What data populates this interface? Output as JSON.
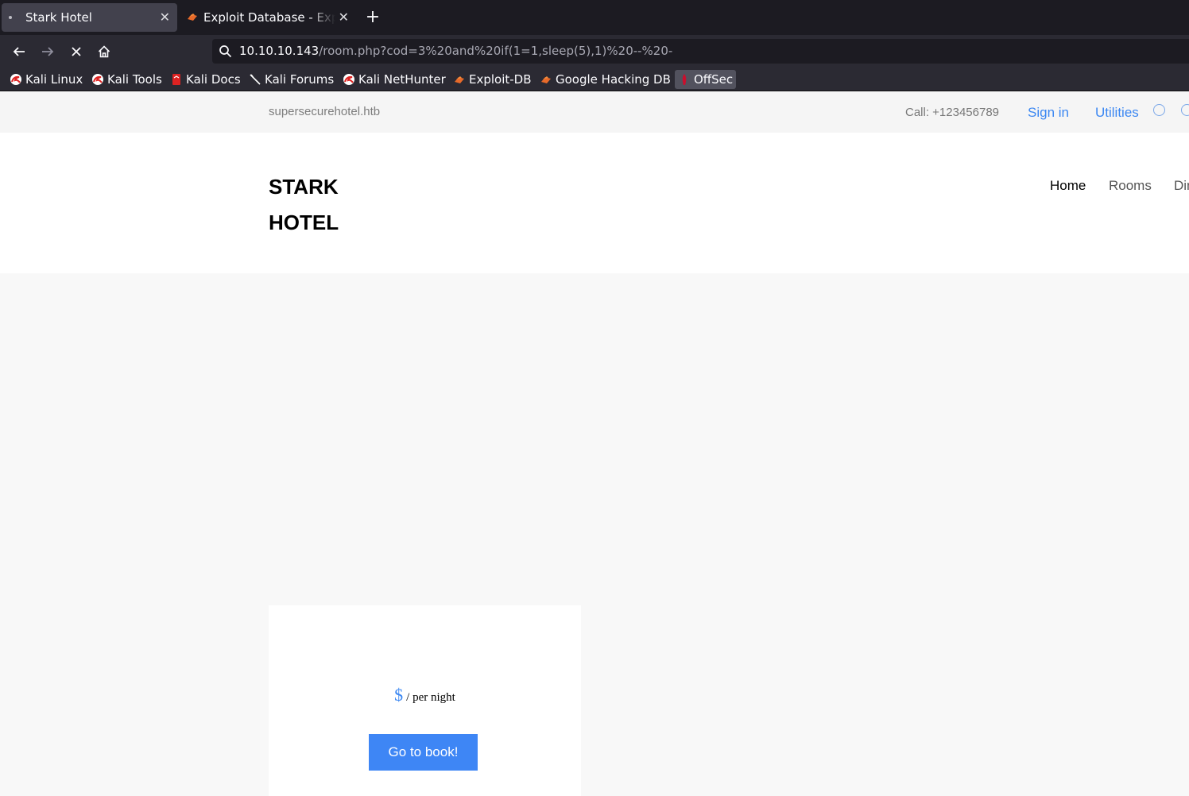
{
  "browser": {
    "tabs": [
      {
        "title": "Stark Hotel",
        "active": true
      },
      {
        "title": "Exploit Database - Exploit",
        "active": false
      }
    ],
    "url": {
      "host": "10.10.10.143",
      "path": "/room.php?cod=3%20and%20if(1=1,sleep(5),1)%20--%20-"
    },
    "bookmarks": [
      {
        "label": "Kali Linux",
        "icon": "kali-icon"
      },
      {
        "label": "Kali Tools",
        "icon": "kali-icon"
      },
      {
        "label": "Kali Docs",
        "icon": "kali-docs-icon"
      },
      {
        "label": "Kali Forums",
        "icon": "kali-forums-icon"
      },
      {
        "label": "Kali NetHunter",
        "icon": "kali-icon"
      },
      {
        "label": "Exploit-DB",
        "icon": "exploit-db-icon"
      },
      {
        "label": "Google Hacking DB",
        "icon": "exploit-db-icon"
      },
      {
        "label": "OffSec",
        "icon": "offsec-icon"
      }
    ]
  },
  "page": {
    "topbar": {
      "domain": "supersecurehotel.htb",
      "call": "Call: +123456789",
      "sign_in": "Sign in",
      "utilities": "Utilities"
    },
    "logo": {
      "line1": "STARK",
      "line2": "HOTEL"
    },
    "menu": [
      "Home",
      "Rooms",
      "Dining"
    ],
    "card": {
      "currency": "$",
      "per_night": "/ per night",
      "book_button": "Go to book!"
    }
  },
  "colors": {
    "accent": "#3b87f2",
    "button": "#3e86f5",
    "chrome_dark": "#1c1b22",
    "chrome": "#2b2a33"
  }
}
